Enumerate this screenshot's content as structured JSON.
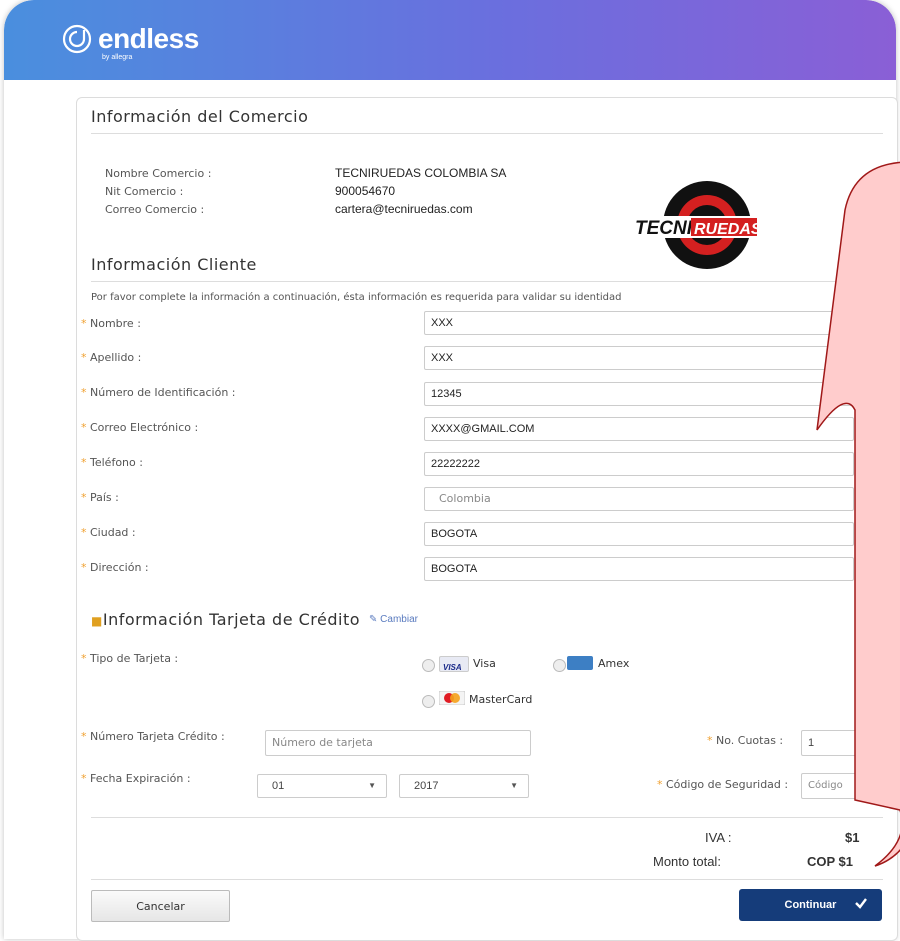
{
  "brand": {
    "name": "endless",
    "sub": "by allegra"
  },
  "merchant": {
    "title": "Información del Comercio",
    "name_label": "Nombre Comercio :",
    "name_value": "TECNIRUEDAS COLOMBIA SA",
    "nit_label": "Nit Comercio :",
    "nit_value": "900054670",
    "email_label": "Correo Comercio :",
    "email_value": "cartera@tecniruedas.com",
    "logo_text_1": "TECNI",
    "logo_text_2": "RUEDAS"
  },
  "client": {
    "title": "Información Cliente",
    "instructions": "Por favor complete la información a continuación, ésta información es requerida para validar su identidad",
    "fields": [
      {
        "label": "Nombre :",
        "value": "XXX"
      },
      {
        "label": "Apellido :",
        "value": "XXX"
      },
      {
        "label": "Número de Identificación :",
        "value": "12345"
      },
      {
        "label": "Correo Electrónico :",
        "value": "XXXX@GMAIL.COM"
      },
      {
        "label": "Teléfono :",
        "value": "22222222"
      },
      {
        "label": "País :",
        "value": "Colombia"
      },
      {
        "label": "Ciudad :",
        "value": "BOGOTA"
      },
      {
        "label": "Dirección :",
        "value": "BOGOTA"
      }
    ]
  },
  "card": {
    "title": "Información Tarjeta de Crédito",
    "change_link": "Cambiar",
    "type_label": "Tipo de Tarjeta :",
    "options": {
      "visa": "Visa",
      "visa_logo": "VISA",
      "amex": "Amex",
      "mastercard": "MasterCard"
    },
    "number_label": "Número Tarjeta Crédito :",
    "number_placeholder": "Número de tarjeta",
    "installments_label": "No. Cuotas :",
    "installments_value": "1",
    "expiry_label": "Fecha Expiración :",
    "expiry_month": "01",
    "expiry_year": "2017",
    "security_label": "Código de Seguridad :",
    "security_placeholder": "Código"
  },
  "totals": {
    "iva_label": "IVA :",
    "iva_value": "$1",
    "total_label": "Monto total:",
    "total_value": "COP $1"
  },
  "actions": {
    "cancel": "Cancelar",
    "continue": "Continuar"
  },
  "colors": {
    "accent": "#153c7a",
    "required": "#f0a030",
    "tooltip_fill": "#ffcccc",
    "tooltip_border": "#a01818"
  }
}
